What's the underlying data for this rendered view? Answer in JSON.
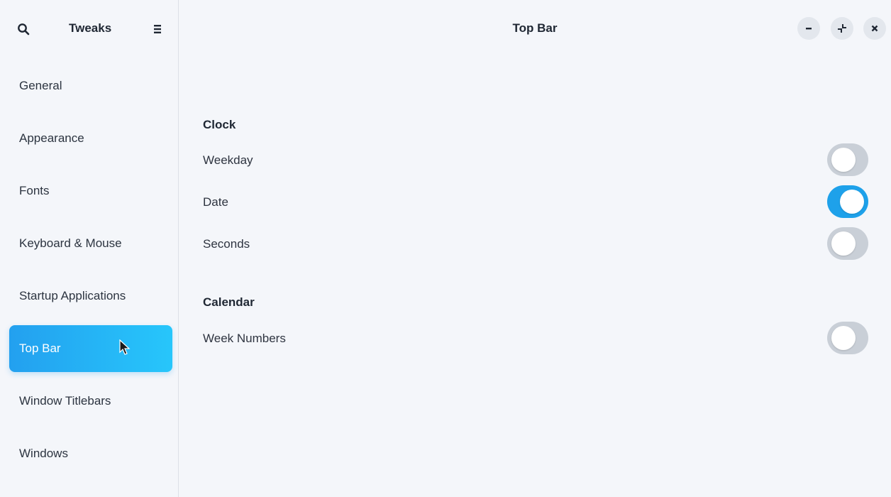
{
  "sidebar": {
    "title": "Tweaks",
    "search_icon": "search-icon",
    "menu_icon": "hamburger-menu-icon",
    "items": [
      {
        "label": "General"
      },
      {
        "label": "Appearance"
      },
      {
        "label": "Fonts"
      },
      {
        "label": "Keyboard & Mouse"
      },
      {
        "label": "Startup Applications"
      },
      {
        "label": "Top Bar",
        "active": true
      },
      {
        "label": "Window Titlebars"
      },
      {
        "label": "Windows"
      }
    ]
  },
  "header": {
    "title": "Top Bar",
    "buttons": [
      "minimize-icon",
      "restore-icon",
      "close-icon"
    ]
  },
  "sections": {
    "clock": {
      "heading": "Clock",
      "weekday": {
        "label": "Weekday",
        "enabled": false
      },
      "date": {
        "label": "Date",
        "enabled": true
      },
      "seconds": {
        "label": "Seconds",
        "enabled": false
      }
    },
    "calendar": {
      "heading": "Calendar",
      "week_numbers": {
        "label": "Week Numbers",
        "enabled": false
      }
    }
  },
  "colors": {
    "accent": "#1ea1ea",
    "background": "#f4f6fa",
    "toggle_off": "#c9cfd7"
  }
}
